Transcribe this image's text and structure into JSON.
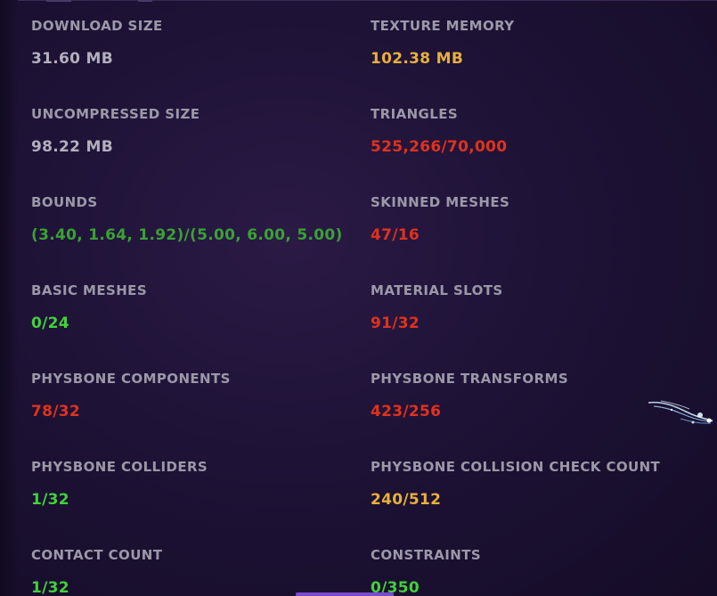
{
  "stats": {
    "download_size": {
      "label": "DOWNLOAD SIZE",
      "value": "31.60 MB",
      "status": "neutral"
    },
    "texture_memory": {
      "label": "TEXTURE MEMORY",
      "value": "102.38 MB",
      "status": "warn"
    },
    "uncompressed_size": {
      "label": "UNCOMPRESSED SIZE",
      "value": "98.22 MB",
      "status": "neutral"
    },
    "triangles": {
      "label": "TRIANGLES",
      "value": "525,266/70,000",
      "status": "bad"
    },
    "bounds": {
      "label": "BOUNDS",
      "value": "(3.40, 1.64, 1.92)/(5.00, 6.00, 5.00)",
      "status": "good"
    },
    "skinned_meshes": {
      "label": "SKINNED MESHES",
      "value": "47/16",
      "status": "bad"
    },
    "basic_meshes": {
      "label": "BASIC MESHES",
      "value": "0/24",
      "status": "good"
    },
    "material_slots": {
      "label": "MATERIAL SLOTS",
      "value": "91/32",
      "status": "bad"
    },
    "physbone_components": {
      "label": "PHYSBONE COMPONENTS",
      "value": "78/32",
      "status": "bad"
    },
    "physbone_transforms": {
      "label": "PHYSBONE TRANSFORMS",
      "value": "423/256",
      "status": "bad"
    },
    "physbone_colliders": {
      "label": "PHYSBONE COLLIDERS",
      "value": "1/32",
      "status": "good"
    },
    "physbone_collision_check_count": {
      "label": "PHYSBONE COLLISION CHECK COUNT",
      "value": "240/512",
      "status": "warn"
    },
    "contact_count": {
      "label": "CONTACT COUNT",
      "value": "1/32",
      "status": "good"
    },
    "constraints": {
      "label": "CONSTRAINTS",
      "value": "0/350",
      "status": "good"
    }
  },
  "colors": {
    "neutral": "#b3b0bd",
    "good": "#41d13b",
    "warn": "#e8b03c",
    "bad": "#e0321e",
    "label": "#9c98a8",
    "background": "#1e1236"
  },
  "icons": {
    "cursor_decoration": "sparkle-cursor-icon"
  }
}
